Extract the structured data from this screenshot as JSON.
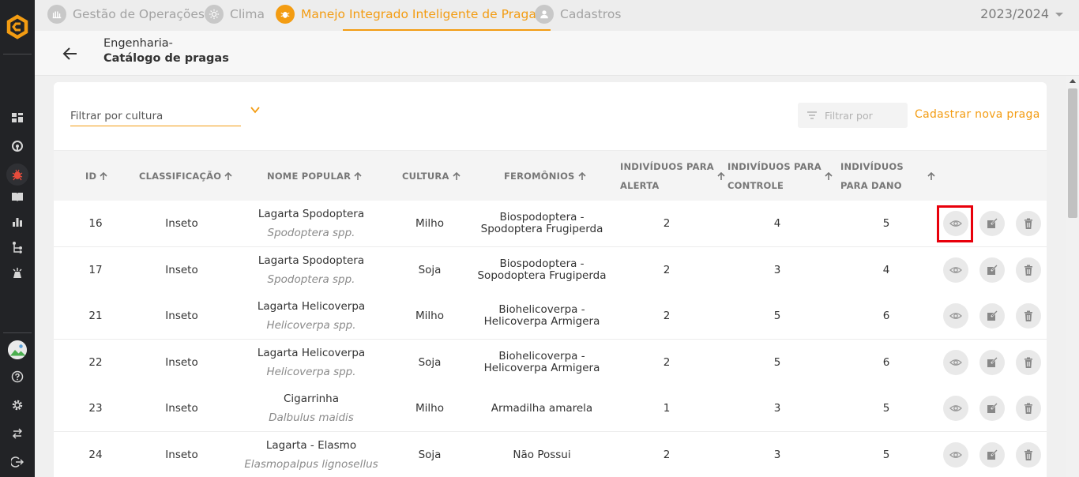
{
  "nav": {
    "tabs": [
      {
        "label": "Gestão de Operações",
        "icon": "operations-icon"
      },
      {
        "label": "Clima",
        "icon": "sun-icon"
      },
      {
        "label": "Manejo Integrado Inteligente de Pragas",
        "icon": "bug-icon"
      },
      {
        "label": "Cadastros",
        "icon": "user-icon"
      }
    ],
    "active_tab": "Manejo Integrado Inteligente de Pragas",
    "season": "2023/2024"
  },
  "header": {
    "crumb_parent": "Engenharia-",
    "crumb_current": "Catálogo de pragas"
  },
  "toolbar": {
    "culture_filter_placeholder": "Filtrar por cultura",
    "filter_placeholder": "Filtrar por",
    "new_pest_label": "Cadastrar nova praga"
  },
  "table": {
    "columns": {
      "id": "ID",
      "classification": "CLASSIFICAÇÃO",
      "popular_name": "NOME POPULAR",
      "culture": "CULTURA",
      "pheromones": "FEROMÔNIOS",
      "alert_1": "INDIVÍDUOS PARA",
      "alert_2": "ALERTA",
      "control_1": "INDIVÍDUOS PARA",
      "control_2": "CONTROLE",
      "damage_1": "INDIVÍDUOS",
      "damage_2": "PARA DANO"
    },
    "rows": [
      {
        "id": "16",
        "classification": "Inseto",
        "name": "Lagarta Spodoptera",
        "scientific": "Spodoptera spp.",
        "culture": "Milho",
        "pheromone_1": "Biospodoptera -",
        "pheromone_2": "Spodoptera Frugiperda",
        "alert": "2",
        "control": "4",
        "damage": "5"
      },
      {
        "id": "17",
        "classification": "Inseto",
        "name": "Lagarta Spodoptera",
        "scientific": "Spodoptera spp.",
        "culture": "Soja",
        "pheromone_1": "Biospodoptera -",
        "pheromone_2": "Sopodoptera Frugiperda",
        "alert": "2",
        "control": "3",
        "damage": "4"
      },
      {
        "id": "21",
        "classification": "Inseto",
        "name": "Lagarta Helicoverpa",
        "scientific": "Helicoverpa spp.",
        "culture": "Milho",
        "pheromone_1": "Biohelicoverpa -",
        "pheromone_2": "Helicoverpa Armigera",
        "alert": "2",
        "control": "5",
        "damage": "6"
      },
      {
        "id": "22",
        "classification": "Inseto",
        "name": "Lagarta Helicoverpa",
        "scientific": "Helicoverpa spp.",
        "culture": "Soja",
        "pheromone_1": "Biohelicoverpa -",
        "pheromone_2": "Helicoverpa Armigera",
        "alert": "2",
        "control": "5",
        "damage": "6"
      },
      {
        "id": "23",
        "classification": "Inseto",
        "name": "Cigarrinha",
        "scientific": "Dalbulus maidis",
        "culture": "Milho",
        "pheromone_1": "Armadilha amarela",
        "pheromone_2": "",
        "alert": "1",
        "control": "3",
        "damage": "5"
      },
      {
        "id": "24",
        "classification": "Inseto",
        "name": "Lagarta - Elasmo",
        "scientific": "Elasmopalpus lignosellus",
        "culture": "Soja",
        "pheromone_1": "Não Possui",
        "pheromone_2": "",
        "alert": "2",
        "control": "3",
        "damage": "5"
      }
    ]
  },
  "colors": {
    "accent": "#f39c12",
    "sidebar": "#222326",
    "highlight": "#e8000b",
    "bug_nav": "#e74c3c"
  }
}
